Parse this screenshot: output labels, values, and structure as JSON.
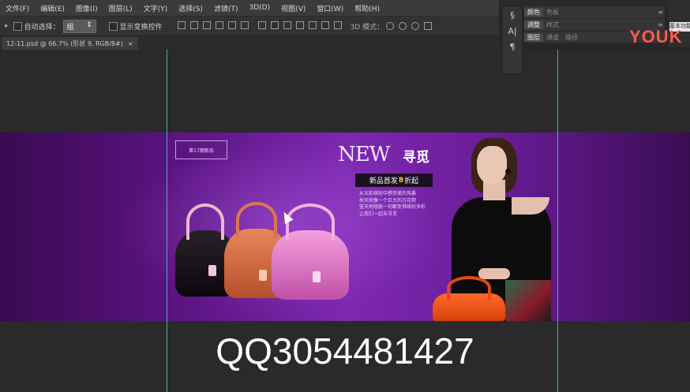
{
  "menu": [
    "文件(F)",
    "编辑(E)",
    "图像(I)",
    "图层(L)",
    "文字(Y)",
    "选择(S)",
    "滤镜(T)",
    "3D(D)",
    "视图(V)",
    "窗口(W)",
    "帮助(H)"
  ],
  "options": {
    "auto_select_label": "自动选择：",
    "auto_select_value": "组",
    "show_transform_label": "显示变换控件",
    "mode_3d_label": "3D 模式："
  },
  "document_tab": {
    "title": "12-11.psd @ 66.7% (形状 9, RGB/8#)",
    "close": "×"
  },
  "banner": {
    "brand": "第17期新品",
    "headline_en": "NEW",
    "headline_cn": "寻觅",
    "promo_prefix": "新品首发",
    "promo_number": "8",
    "promo_suffix": "折起",
    "desc_lines": [
      "从五彩缤纷中感受美的风暴",
      "秋天就像一个巨大的万花筒",
      "蓝天地毯般一切都变得缤纷多彩",
      "让我们一起去寻觅"
    ]
  },
  "watermark": "QQ3054481427",
  "panels": {
    "row1": [
      "颜色",
      "色板"
    ],
    "row2": [
      "调整",
      "样式"
    ],
    "row3": [
      "图层",
      "通道",
      "路径"
    ],
    "menu_glyph": "≡"
  },
  "side_icons": [
    "character-paragraph-icon",
    "A|",
    "¶"
  ],
  "right_button": "基本功能",
  "logo": "YOUK",
  "colors": {
    "banner_purple": "#7c28b0",
    "guide": "#3fc8c8",
    "promo_highlight": "#ffcc33",
    "logo": "#ff5a4e"
  }
}
